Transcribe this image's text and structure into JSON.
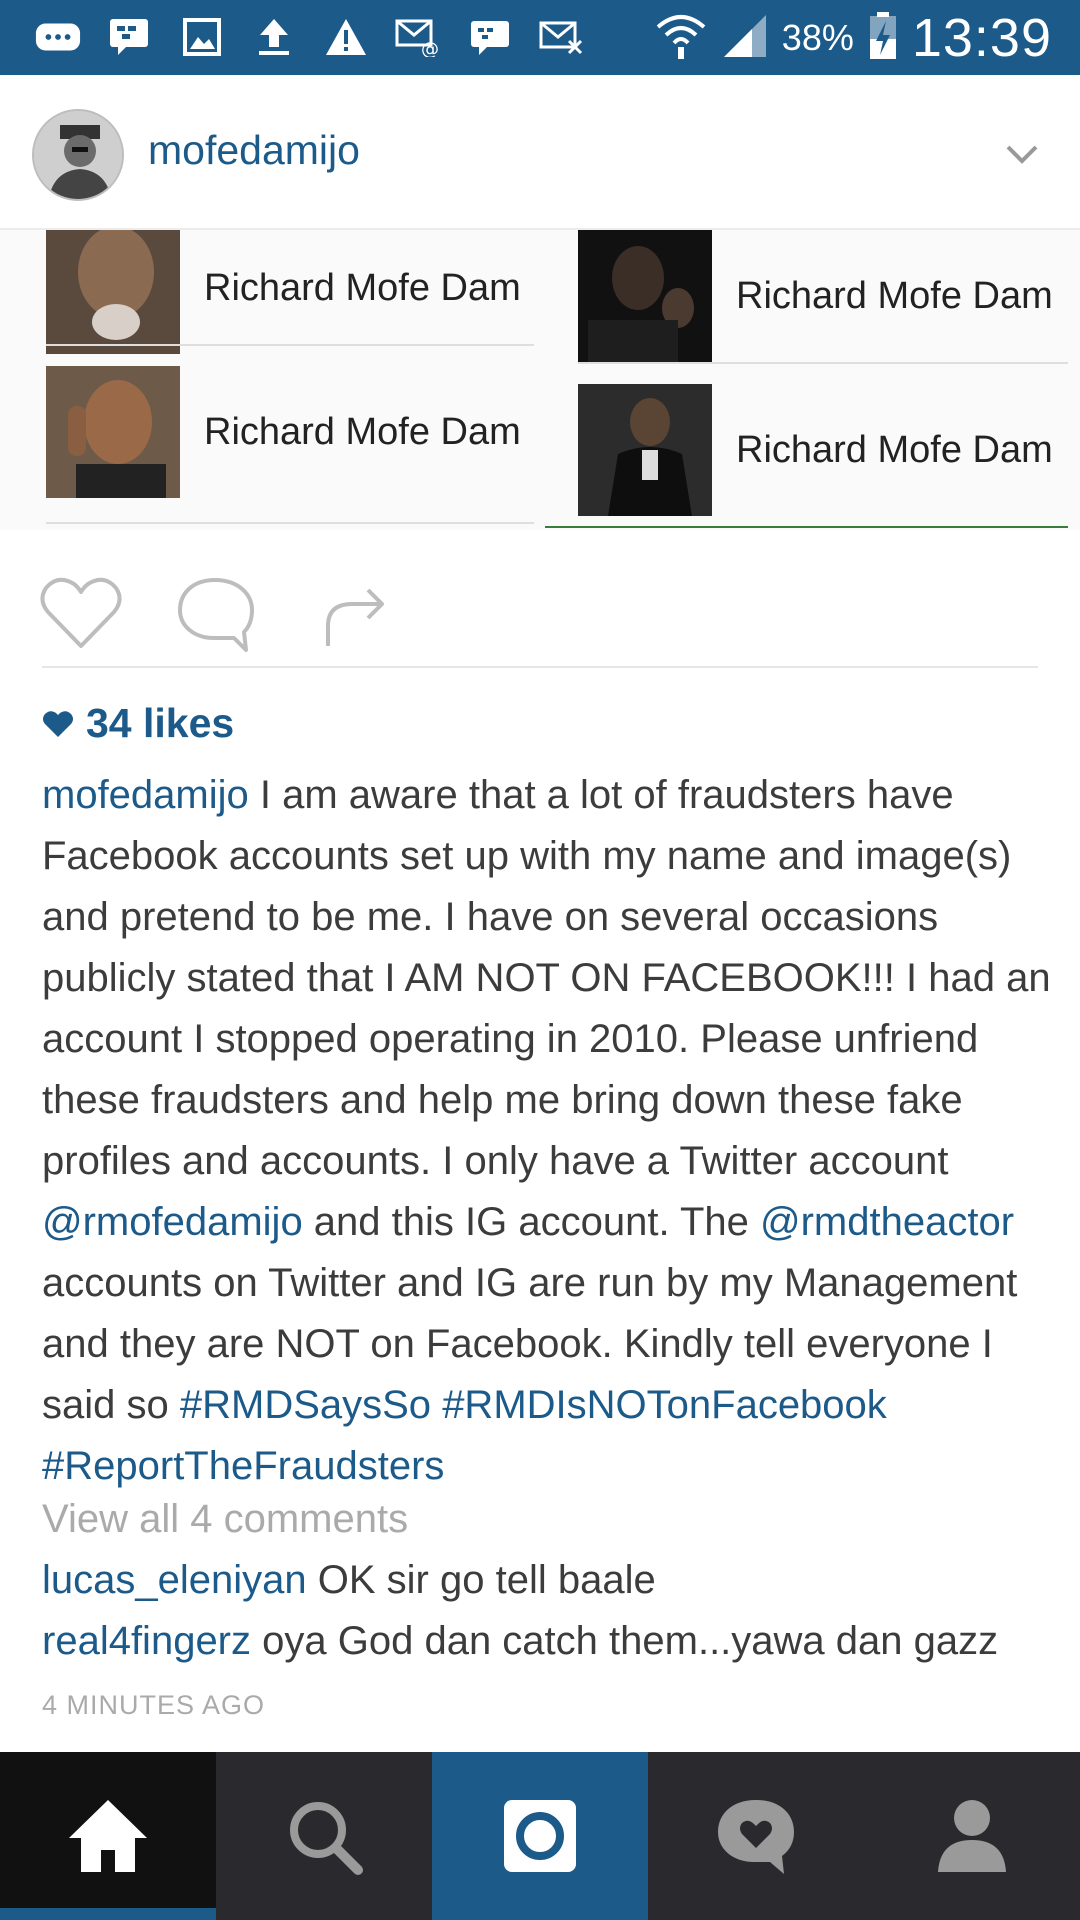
{
  "status_bar": {
    "battery": "38%",
    "time": "13:39",
    "icons": [
      "message-icon",
      "bbm-icon",
      "gallery-icon",
      "upload-icon",
      "warning-icon",
      "email-icon",
      "bbm-chat-icon",
      "missed-email-icon",
      "wifi-icon",
      "signal-icon",
      "battery-charging-icon"
    ]
  },
  "post": {
    "username": "mofedamijo",
    "photo_cards": [
      {
        "name": "Richard Mofe Dam"
      },
      {
        "name": "Richard Mofe Dam"
      },
      {
        "name": "Richard Mofe Dam"
      },
      {
        "name": "Richard Mofe Dam"
      }
    ],
    "likes": "34 likes",
    "caption": {
      "author": "mofedamijo",
      "text_1": " I am aware that a lot of fraudsters have Facebook accounts set up with my name and image(s) and pretend to be me. I have on several occasions publicly stated that I AM NOT ON FACEBOOK!!! I had an account I stopped operating in 2010. Please unfriend these fraudsters and help me bring down these fake profiles and accounts. I only have a Twitter account ",
      "mention_1": "@rmofedamijo",
      "text_2": " and this IG account. The ",
      "mention_2": "@rmdtheactor",
      "text_3": " accounts on Twitter and IG are run by my Management and they are NOT on Facebook. Kindly tell everyone I said so ",
      "hashtag_1": "#RMDSaysSo",
      "hashtag_2": "#RMDIsNOTonFacebook",
      "hashtag_3": "#ReportTheFraudsters"
    },
    "view_all": "View all 4 comments",
    "comments": [
      {
        "user": "lucas_eleniyan",
        "text": " OK sir go tell baale"
      },
      {
        "user": "real4fingerz",
        "text": " oya God dan catch them...yawa dan gazz"
      }
    ],
    "time_ago": "4 MINUTES AGO"
  },
  "bottom_nav": [
    "home-icon",
    "search-icon",
    "camera-icon",
    "activity-icon",
    "profile-icon"
  ],
  "colors": {
    "accent": "#1c5a8a",
    "muted": "#aaaaaa",
    "nav_bg": "#2a2a2e"
  }
}
